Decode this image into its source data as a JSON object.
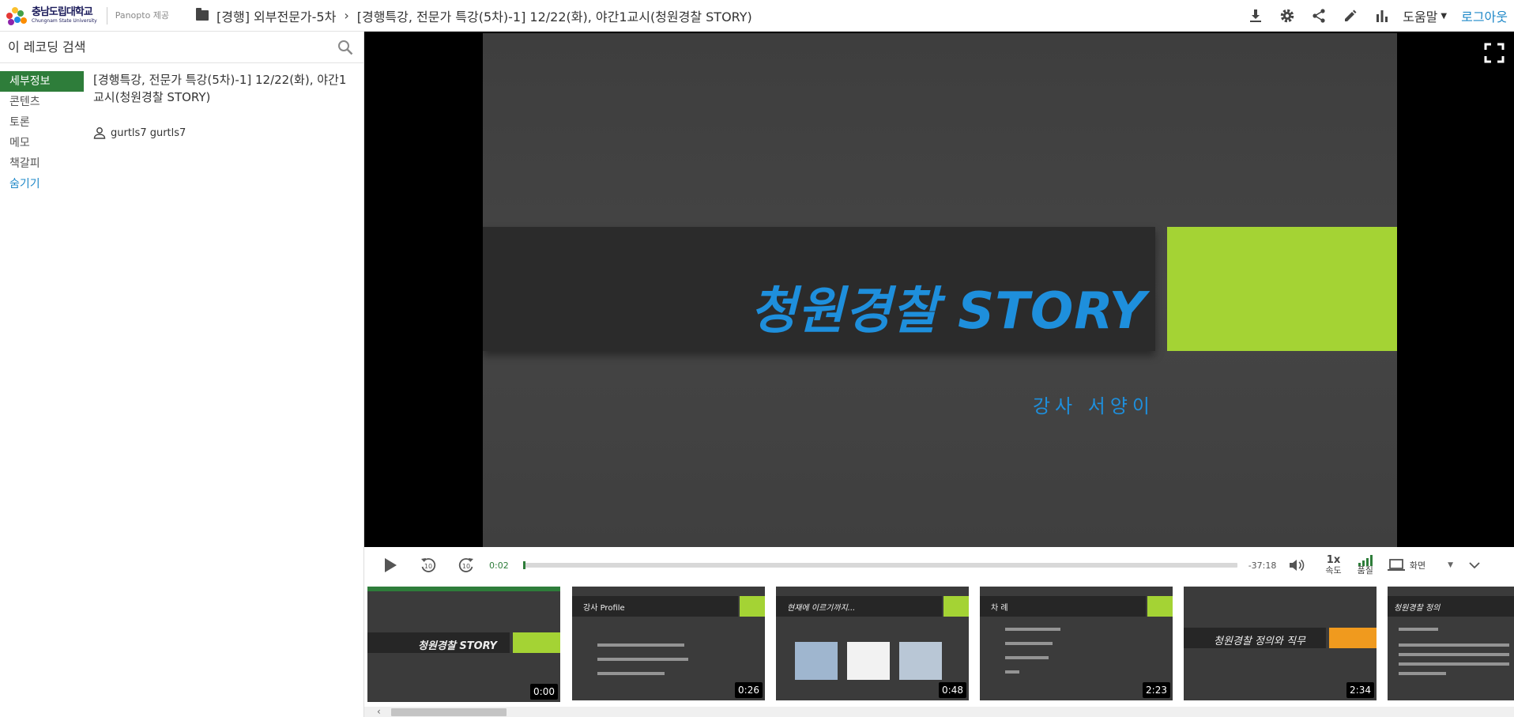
{
  "header": {
    "logo_ko": "충남도립대학교",
    "logo_en": "Chungnam State University",
    "provider": "Panopto 제공",
    "breadcrumb_folder": "[경행] 외부전문가-5차",
    "breadcrumb_session": "[경행특강, 전문가 특강(5차)-1] 12/22(화), 야간1교시(청원경찰 STORY)",
    "icons": [
      "download-icon",
      "gear-icon",
      "share-icon",
      "pencil-icon",
      "stats-icon"
    ],
    "help_label": "도움말",
    "logout_label": "로그아웃"
  },
  "sidebar": {
    "search_placeholder": "이 레코딩 검색",
    "items": [
      {
        "label": "세부정보",
        "active": true
      },
      {
        "label": "콘텐츠"
      },
      {
        "label": "토론"
      },
      {
        "label": "메모"
      },
      {
        "label": "책갈피"
      },
      {
        "label": "숨기기"
      }
    ],
    "details_title": "[경행특강, 전문가 특강(5차)-1] 12/22(화), 야간1교시(청원경찰 STORY)",
    "owner": "gurtls7 gurtls7"
  },
  "slide": {
    "title": "청원경찰  STORY",
    "lecturer": "강사 서양이"
  },
  "controls": {
    "current_time": "0:02",
    "remaining_time": "-37:18",
    "progress_fraction": 0.001,
    "speed_value": "1x",
    "speed_label": "속도",
    "quality_label": "품질",
    "screen_label": "화면"
  },
  "thumbnails": [
    {
      "title": "청원경찰  STORY",
      "time": "0:00",
      "active": true
    },
    {
      "title": "강사  Profile",
      "time": "0:26"
    },
    {
      "title": "현재에 이르기까지...",
      "time": "0:48"
    },
    {
      "title": "차      례",
      "time": "2:23"
    },
    {
      "title": "청원경찰  정의와 직무",
      "time": "2:34"
    },
    {
      "title": "청원경찰  정의",
      "time": ""
    }
  ],
  "colors": {
    "accent_green": "#2e7d3a",
    "slide_lime": "#a4d334",
    "slide_blue": "#1e8fdc",
    "link_blue": "#1e88c8"
  }
}
